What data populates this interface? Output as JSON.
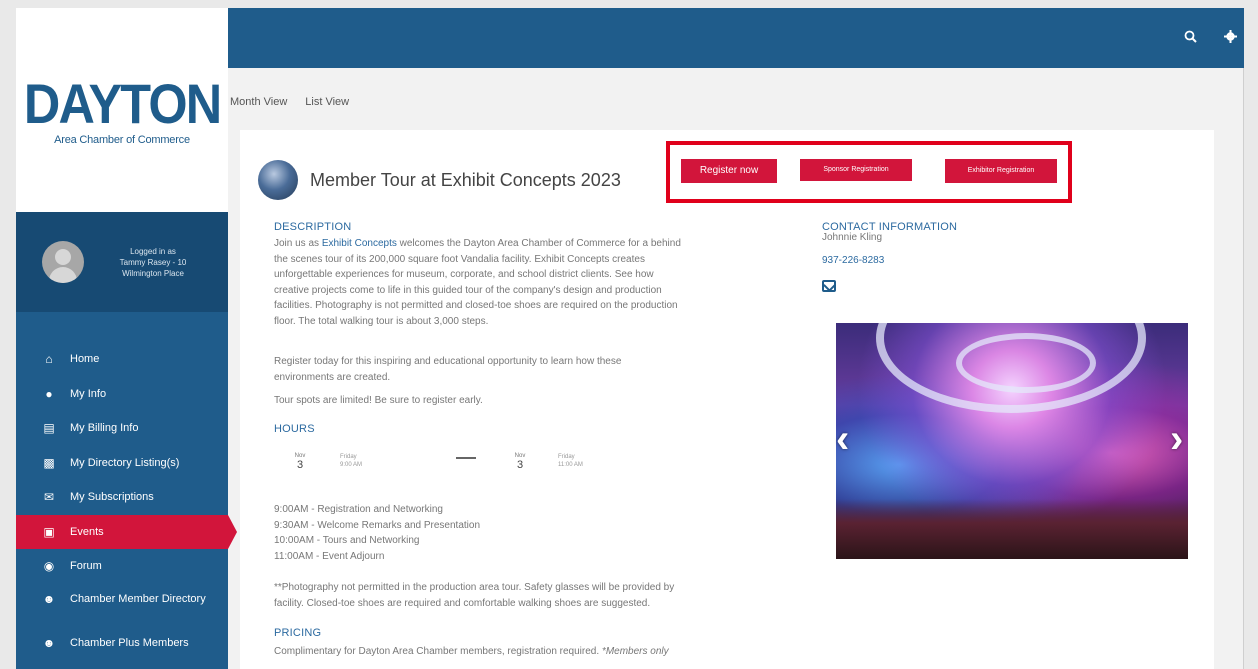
{
  "logo": {
    "word": "DAYTON",
    "sub": "Area Chamber of Commerce"
  },
  "user": {
    "line1": "Logged in as",
    "line2": "Tammy Rasey - 10",
    "line3": "Wilmington Place"
  },
  "nav": [
    {
      "label": "Home",
      "icon": "home-icon"
    },
    {
      "label": "My Info",
      "icon": "user-icon"
    },
    {
      "label": "My Billing Info",
      "icon": "credit-card-icon"
    },
    {
      "label": "My Directory Listing(s)",
      "icon": "id-card-icon"
    },
    {
      "label": "My Subscriptions",
      "icon": "envelope-icon"
    },
    {
      "label": "Events",
      "icon": "calendar-icon",
      "active": true
    },
    {
      "label": "Forum",
      "icon": "comments-icon"
    },
    {
      "label": "Chamber Member Directory",
      "icon": "users-icon"
    },
    {
      "label": "Chamber Plus Members",
      "icon": "users-icon"
    }
  ],
  "tabs": {
    "month": "Month View",
    "list": "List View"
  },
  "event": {
    "title": "Member Tour at Exhibit Concepts 2023",
    "buttons": {
      "register": "Register now",
      "sponsor": "Sponsor Registration",
      "exhibitor": "Exhibitor Registration"
    }
  },
  "description": {
    "heading": "DESCRIPTION",
    "p1_lead": "Join us as",
    "p1_link": "Exhibit Concepts",
    "p1_l1": "welcomes the Dayton Area Chamber of Commerce for a behind",
    "p1_l2": "the scenes tour of its 200,000 square foot Vandalia facility. Exhibit Concepts creates",
    "p1_l3": "unforgettable experiences for museum, corporate, and school district clients. See how",
    "p1_l4": "creative projects come to life in this guided tour of the company's design and production",
    "p1_l5": "facilities. Photography is not permitted and closed-toe shoes are required on the production",
    "p1_l6": "floor. The total walking tour is about 3,000 steps.",
    "p2_l1": "Register today for this inspiring and educational opportunity to learn how these",
    "p2_l2": "environments are created.",
    "p3": "Tour spots are limited! Be sure to register early."
  },
  "hours": {
    "heading": "HOURS",
    "start": {
      "month": "Nov",
      "day": "3",
      "weekday": "Friday",
      "time": "9:00 AM"
    },
    "end": {
      "month": "Nov",
      "day": "3",
      "weekday": "Friday",
      "time": "11:00 AM"
    },
    "agenda": [
      "9:00AM - Registration and Networking",
      "9:30AM - Welcome Remarks and Presentation",
      "10:00AM - Tours and Networking",
      "11:00AM - Event Adjourn"
    ],
    "note_l1": "**Photography not permitted in the production area tour. Safety glasses will be provided by",
    "note_l2": "facility. Closed-toe shoes are required and comfortable walking shoes are suggested."
  },
  "pricing": {
    "heading": "PRICING",
    "text": "Complimentary for Dayton Area Chamber members, registration required.",
    "note": "*Members only"
  },
  "contact": {
    "heading": "CONTACT INFORMATION",
    "name": "Johnnie Kling",
    "phone": "937-226-8283"
  }
}
